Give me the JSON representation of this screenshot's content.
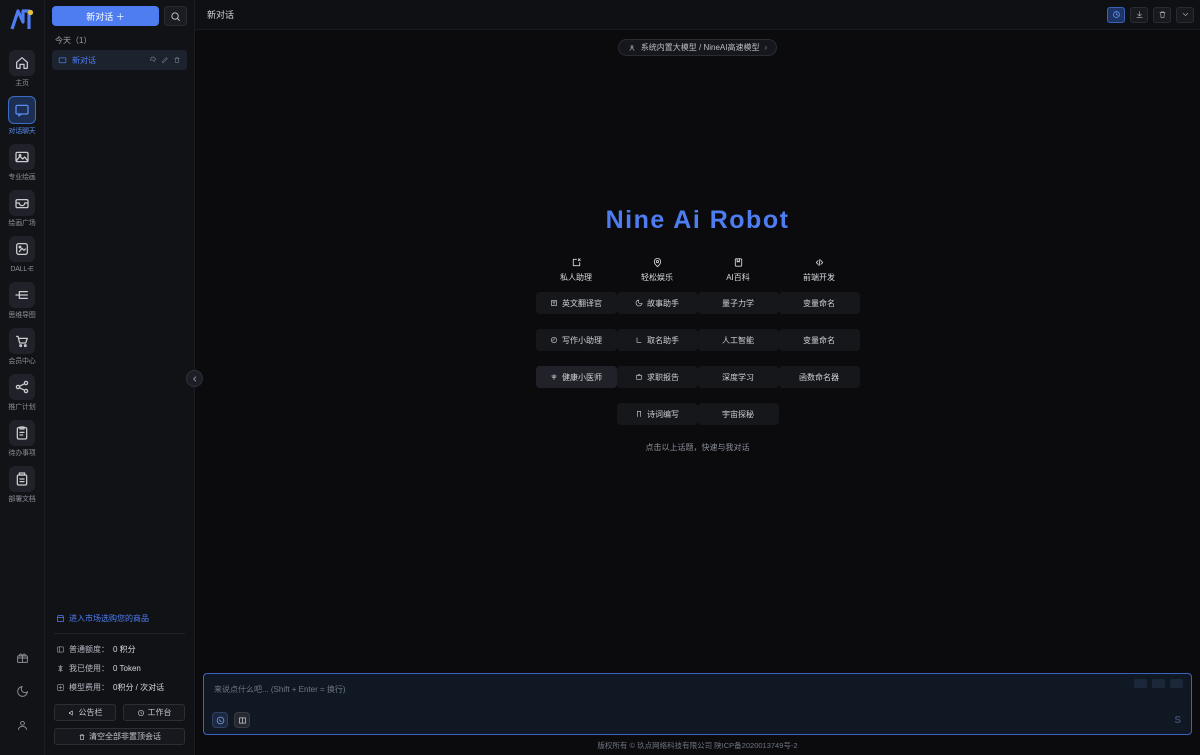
{
  "rail": {
    "logo_alt": "nineai-logo",
    "items": [
      {
        "label": "主页",
        "icon": "home-icon",
        "active": false
      },
      {
        "label": "对话聊天",
        "icon": "chat-icon",
        "active": true
      },
      {
        "label": "专业绘画",
        "icon": "image-icon",
        "active": false
      },
      {
        "label": "绘画广场",
        "icon": "gallery-icon",
        "active": false
      },
      {
        "label": "DALL-E",
        "icon": "dalle-icon",
        "active": false
      },
      {
        "label": "思维导图",
        "icon": "mindmap-icon",
        "active": false
      },
      {
        "label": "会员中心",
        "icon": "cart-icon",
        "active": false
      },
      {
        "label": "推广计划",
        "icon": "share-icon",
        "active": false
      },
      {
        "label": "待办事项",
        "icon": "todo-icon",
        "active": false
      },
      {
        "label": "部署文档",
        "icon": "doc-icon",
        "active": false
      }
    ],
    "bottom_icons": [
      "gift-icon",
      "moon-icon",
      "user-icon"
    ]
  },
  "sidebar": {
    "new_chat_label": "新对话 ＋",
    "search_icon": "search-icon",
    "group_label": "今天（1）",
    "conversations": [
      {
        "title": "新对话",
        "icon": "chat-bubble-icon",
        "actions": [
          "pin-icon",
          "edit-icon",
          "delete-icon"
        ]
      }
    ],
    "market_link": "进入市场选购您的商品",
    "stats": [
      {
        "icon": "credit-icon",
        "label": "普通额度：",
        "value": "0 积分"
      },
      {
        "icon": "usage-icon",
        "label": "我已使用：",
        "value": "0 Token"
      },
      {
        "icon": "price-icon",
        "label": "模型费用：",
        "value": "0积分 / 次对话"
      }
    ],
    "buttons": {
      "notice": "公告栏",
      "workbench": "工作台",
      "clear_all": "清空全部非置顶会话"
    },
    "collapse_icon": "chevron-left-icon"
  },
  "header": {
    "title": "新对话",
    "actions": [
      {
        "icon": "history-icon",
        "accent": true
      },
      {
        "icon": "download-icon",
        "accent": false
      },
      {
        "icon": "trash-icon",
        "accent": false
      },
      {
        "icon": "chevron-down-icon",
        "accent": false
      }
    ]
  },
  "model_selector": {
    "icon": "model-icon",
    "label": "系统内置大模型 / NineAI高速模型",
    "chevron": "›"
  },
  "hero": {
    "title": "Nine Ai Robot",
    "hint": "点击以上话题，快速与我对话",
    "categories": [
      {
        "name": "私人助理",
        "icon": "assistant-icon"
      },
      {
        "name": "轻松娱乐",
        "icon": "location-icon"
      },
      {
        "name": "AI百科",
        "icon": "book-icon"
      },
      {
        "name": "前端开发",
        "icon": "code-icon"
      }
    ],
    "topics": [
      [
        {
          "label": "英文翻译官",
          "icon": "translate-icon",
          "highlight": false
        },
        {
          "label": "故事助手",
          "icon": "moon-small-icon",
          "highlight": false
        },
        {
          "label": "量子力学",
          "icon": "",
          "highlight": false
        },
        {
          "label": "变量命名",
          "icon": "",
          "highlight": false
        }
      ],
      [
        {
          "label": "写作小助理",
          "icon": "pen-icon",
          "highlight": false
        },
        {
          "label": "取名助手",
          "icon": "name-icon",
          "highlight": false
        },
        {
          "label": "人工智能",
          "icon": "",
          "highlight": false
        },
        {
          "label": "变量命名",
          "icon": "",
          "highlight": false
        }
      ],
      [
        {
          "label": "健康小医师",
          "icon": "health-icon",
          "highlight": true
        },
        {
          "label": "求职报告",
          "icon": "job-icon",
          "highlight": false
        },
        {
          "label": "深度学习",
          "icon": "",
          "highlight": false
        },
        {
          "label": "函数命名器",
          "icon": "",
          "highlight": false
        }
      ],
      [
        {
          "label": "",
          "icon": "",
          "highlight": false
        },
        {
          "label": "诗词编写",
          "icon": "poem-icon",
          "highlight": false
        },
        {
          "label": "宇宙探秘",
          "icon": "",
          "highlight": false
        },
        {
          "label": "",
          "icon": "",
          "highlight": false
        }
      ]
    ]
  },
  "composer": {
    "placeholder": "来说点什么吧... (Shift + Enter = 换行)",
    "tools": [
      {
        "icon": "voice-icon",
        "accent": true
      },
      {
        "icon": "panel-icon",
        "accent": false
      }
    ],
    "send_label": "S"
  },
  "footer": {
    "text": "版权所有 © 玖点网络科技有限公司 陕ICP备2020013749号-2"
  },
  "colors": {
    "accent": "#4e7df2",
    "bg": "#0b0b0e",
    "panel": "#111216",
    "rail": "#121317"
  }
}
